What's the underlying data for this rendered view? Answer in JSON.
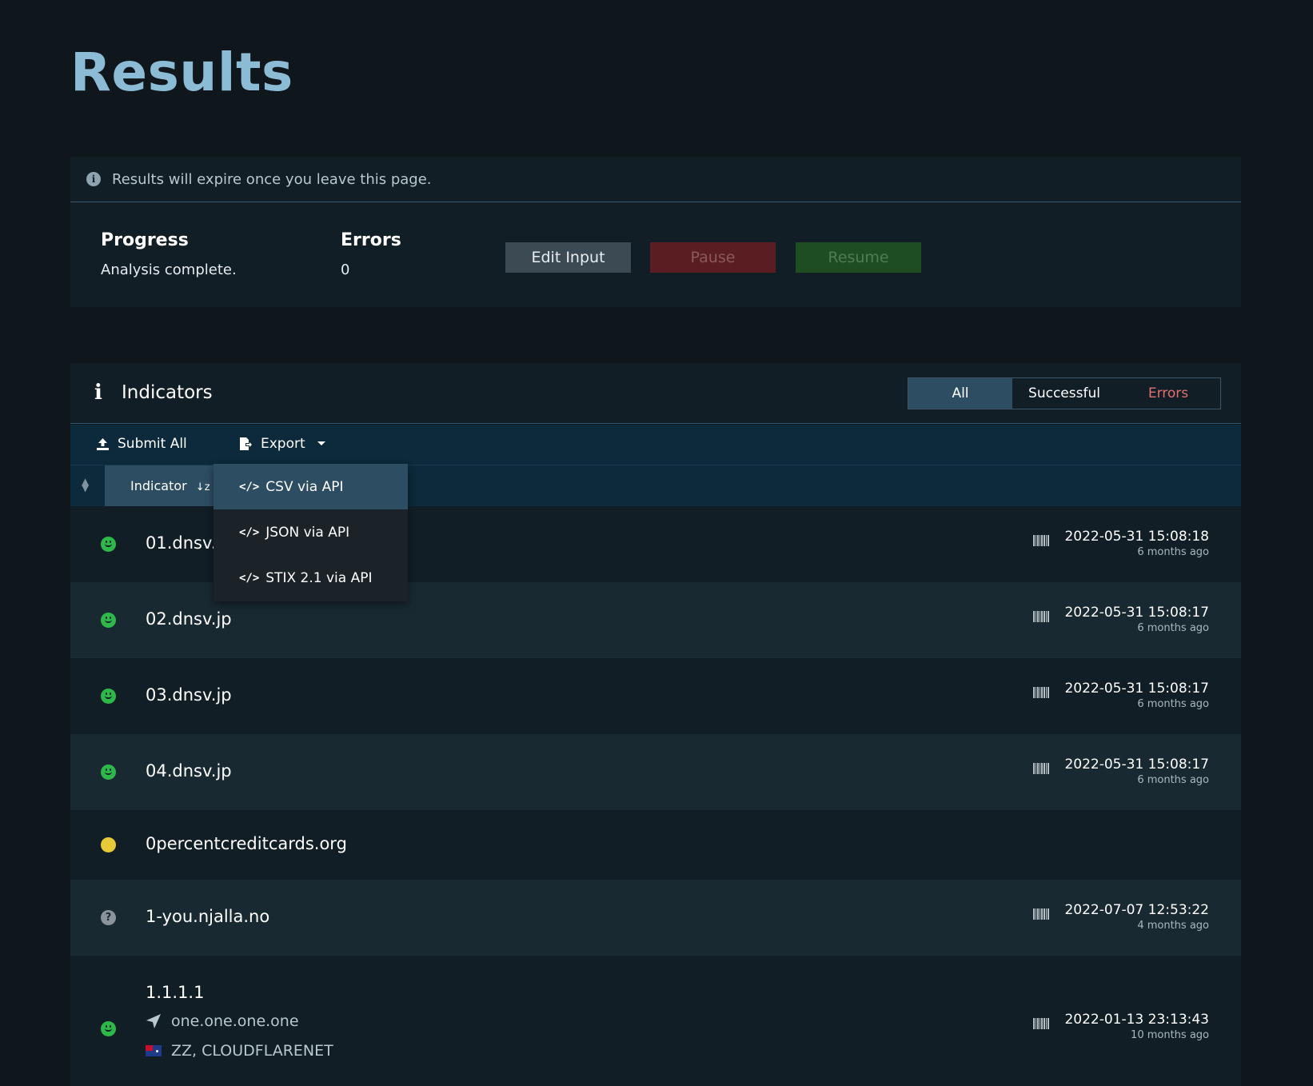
{
  "page": {
    "title": "Results"
  },
  "notice": {
    "text": "Results will expire once you leave this page."
  },
  "progress": {
    "label": "Progress",
    "value": "Analysis complete."
  },
  "errors": {
    "label": "Errors",
    "value": "0"
  },
  "buttons": {
    "edit": "Edit Input",
    "pause": "Pause",
    "resume": "Resume"
  },
  "indicators": {
    "title": "Indicators",
    "filters": {
      "all": "All",
      "successful": "Successful",
      "errors": "Errors"
    },
    "toolbar": {
      "submit_all": "Submit All",
      "export": "Export"
    },
    "column": {
      "indicator": "Indicator"
    },
    "export_menu": [
      "CSV via API",
      "JSON via API",
      "STIX 2.1 via API"
    ],
    "rows": [
      {
        "name": "01.dnsv.jp",
        "visible_name": "01.dnsv.j",
        "status": "ok",
        "date": "2022-05-31 15:08:18",
        "ago": "6 months ago"
      },
      {
        "name": "02.dnsv.jp",
        "status": "ok",
        "date": "2022-05-31 15:08:17",
        "ago": "6 months ago"
      },
      {
        "name": "03.dnsv.jp",
        "status": "ok",
        "date": "2022-05-31 15:08:17",
        "ago": "6 months ago"
      },
      {
        "name": "04.dnsv.jp",
        "status": "ok",
        "date": "2022-05-31 15:08:17",
        "ago": "6 months ago"
      },
      {
        "name": "0percentcreditcards.org",
        "status": "warn"
      },
      {
        "name": "1-you.njalla.no",
        "status": "unknown",
        "date": "2022-07-07 12:53:22",
        "ago": "4 months ago"
      },
      {
        "name": "1.1.1.1",
        "status": "ok",
        "hostname": "one.one.one.one",
        "geo": "ZZ, CLOUDFLARENET",
        "date": "2022-01-13 23:13:43",
        "ago": "10 months ago"
      }
    ]
  },
  "colors": {
    "accent": "#8cbbd6",
    "ok": "#2fb84a",
    "warn": "#e8c93a",
    "error_text": "#e2706e"
  }
}
